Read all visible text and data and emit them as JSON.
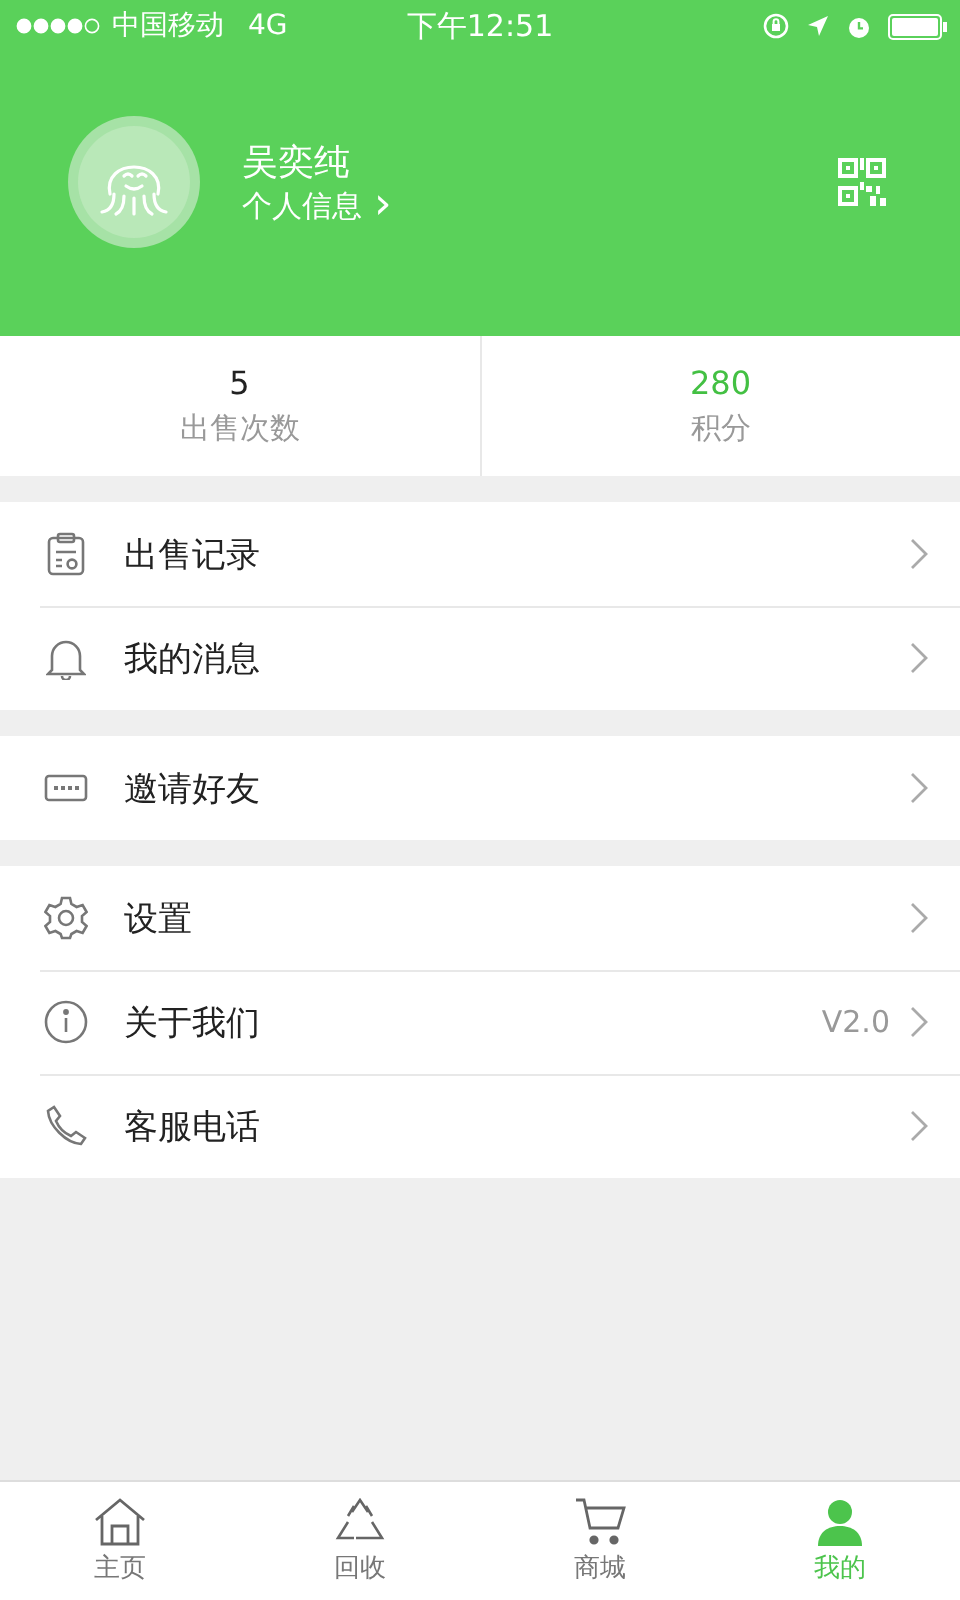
{
  "status_bar": {
    "carrier": "中国移动",
    "network": "4G",
    "time": "下午12:51"
  },
  "profile": {
    "name": "吴奕纯",
    "link": "个人信息",
    "chevron": "›"
  },
  "stats": [
    {
      "value": "5",
      "label": "出售次数",
      "highlight": false
    },
    {
      "value": "280",
      "label": "积分",
      "highlight": true
    }
  ],
  "menu_groups": [
    [
      {
        "label": "出售记录"
      },
      {
        "label": "我的消息"
      }
    ],
    [
      {
        "label": "邀请好友"
      }
    ],
    [
      {
        "label": "设置"
      },
      {
        "label": "关于我们",
        "value": "V2.0"
      },
      {
        "label": "客服电话"
      }
    ]
  ],
  "tab_bar": [
    {
      "label": "主页",
      "selected": false
    },
    {
      "label": "回收",
      "selected": false
    },
    {
      "label": "商城",
      "selected": false
    },
    {
      "label": "我的",
      "selected": true
    }
  ]
}
